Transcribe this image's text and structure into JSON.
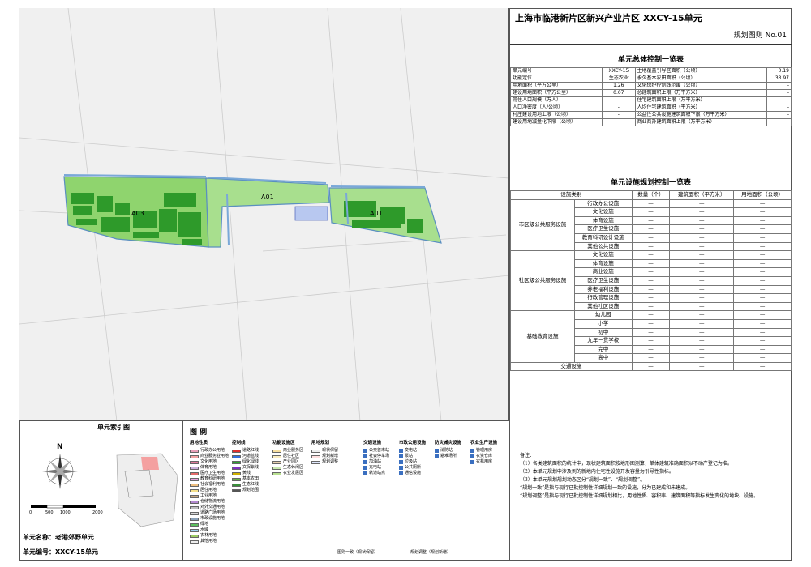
{
  "title": {
    "main": "上海市临港新片区新兴产业片区 XXCY-15单元",
    "sub": "规划图则 No.01"
  },
  "map": {
    "labels": [
      "A03",
      "A01",
      "A01"
    ]
  },
  "table1": {
    "title": "单元总体控制一览表",
    "rows": [
      [
        "单元编号",
        "XXCY-15",
        "主地覆盖引导区面积（公顷）",
        "0.19"
      ],
      [
        "功能定位",
        "生态农业",
        "永久基本农田面积（公顷）",
        "33.97"
      ],
      [
        "用地面积（平方公里）",
        "1.26",
        "文化保护控制线范围（公顷）",
        "-"
      ],
      [
        "建设用地面积（平方公里）",
        "0.07",
        "总建筑面积上限（万平方米）",
        "-"
      ],
      [
        "常住人口规模（万人）",
        "-",
        "住宅建筑面积上限（万平方米）",
        "-"
      ],
      [
        "人口净密度（人/公顷）",
        "-",
        "人均住宅建筑面积（平方米）",
        "-"
      ],
      [
        "村庄建设用地上限（公顷）",
        "-",
        "公益性公共设施建筑面积下限（万平方米）",
        "-"
      ],
      [
        "建设用地减量化下限（公顷）",
        "-",
        "商业商办建筑面积上限（万平方米）",
        "-"
      ]
    ]
  },
  "table2": {
    "title": "单元设施规划控制一览表",
    "headers": [
      "设施类别",
      "数量（个）",
      "建筑面积（平方米）",
      "用地面积（公顷）"
    ],
    "groups": [
      {
        "name": "市区级公共服务设施",
        "items": [
          "行政办公设施",
          "文化设施",
          "体育设施",
          "医疗卫生设施",
          "教育科研设计设施",
          "其他公共设施"
        ]
      },
      {
        "name": "社区级公共服务设施",
        "items": [
          "文化设施",
          "体育设施",
          "商业设施",
          "医疗卫生设施",
          "养老福利设施",
          "行政管理设施",
          "其他社区设施"
        ]
      },
      {
        "name": "基础教育设施",
        "items": [
          "幼儿园",
          "小学",
          "初中",
          "九年一贯学校",
          "完中",
          "高中"
        ]
      }
    ],
    "last_row": "交通设施",
    "dash": "—"
  },
  "notes": {
    "title": "备注：",
    "lines": [
      "（1）各类建筑面积的统计中，现状建筑面积按地形图测算，单体建筑准确面积以不动产登记为准。",
      "（2）本单元规划中涉及到的新地内住宅性设施开发容量为引导性指标。",
      "（3）本单元规划规划动态区分“规划一致”、“规划调整”。",
      "“规划一致”是指与现行已批控制性详细规划一致的设施，分为已建成和未建成。",
      "“规划调整”是指与现行已批控制性详细规划相比，用地性质、容积率、建筑面积等指标发生变化的地块、设施。"
    ]
  },
  "index_map": {
    "title": "单元索引图",
    "north": "N",
    "scale": [
      "0",
      "500",
      "1000",
      "2000"
    ]
  },
  "unit": {
    "name": "单元名称：老港郊野单元",
    "code": "单元编号：XXCY-15单元"
  },
  "legend": {
    "title": "图  例",
    "columns": [
      {
        "head": "用地性质",
        "items": [
          [
            "行政办公用地",
            "#e8a0b8"
          ],
          [
            "商业服务业用地",
            "#f2a3a3"
          ],
          [
            "文化用地",
            "#e07a9a"
          ],
          [
            "体育用地",
            "#c8b0d8"
          ],
          [
            "医疗卫生用地",
            "#e46a6a"
          ],
          [
            "教育科研用地",
            "#e9a2e0"
          ],
          [
            "社会福利用地",
            "#f0c080"
          ],
          [
            "居住用地",
            "#f5e08a"
          ],
          [
            "工业用地",
            "#c8a882"
          ],
          [
            "仓储物流用地",
            "#b48ad0"
          ],
          [
            "对外交通用地",
            "#c0c0c0"
          ],
          [
            "道路广场用地",
            "#d8d8d8"
          ],
          [
            "市政设施用地",
            "#8aa0b8"
          ],
          [
            "绿地",
            "#5cbf5c"
          ],
          [
            "水域",
            "#9ad0ee"
          ],
          [
            "农林用地",
            "#9ccc65"
          ],
          [
            "其他用地",
            "#eeeeee"
          ]
        ]
      },
      {
        "head": "控制线",
        "items": [
          [
            "道路红线",
            "#e03030"
          ],
          [
            "河道蓝线",
            "#3070e0"
          ],
          [
            "绿化绿线",
            "#30a030"
          ],
          [
            "文保紫线",
            "#8030c0"
          ],
          [
            "黄线",
            "#d0b000"
          ],
          [
            "基本农田",
            "#6ab04c"
          ],
          [
            "生态红线",
            "#3a8f3a"
          ],
          [
            "规划范围",
            "#555555"
          ]
        ]
      },
      {
        "head": "功能设施区",
        "items": [
          [
            "商业服务区",
            "#f8e0a0"
          ],
          [
            "居住社区",
            "#fbeec0"
          ],
          [
            "产业园区",
            "#e8d0b0"
          ],
          [
            "生态休闲区",
            "#c9e9b0"
          ],
          [
            "农业发展区",
            "#b8e090"
          ]
        ]
      },
      {
        "head": "用地规划",
        "items": [
          [
            "现状保留",
            "#eeeeee"
          ],
          [
            "规划新增",
            "#ffe0e0"
          ],
          [
            "规划调整",
            "#e0e8ff"
          ]
        ]
      }
    ],
    "icon_cols": [
      {
        "head": "交通设施",
        "items": [
          "公交首末站",
          "社会停车场",
          "加油站",
          "充电站",
          "轨道站点"
        ]
      },
      {
        "head": "市政公用设施",
        "items": [
          "变电站",
          "泵站",
          "垃圾站",
          "公共厕所",
          "通信设施"
        ]
      },
      {
        "head": "防灾减灾设施",
        "items": [
          "消防站",
          "避难场所"
        ]
      },
      {
        "head": "农业生产设施",
        "items": [
          "管理用房",
          "农资仓库",
          "农机用房"
        ]
      }
    ],
    "footer": [
      "图则一致（现状保留）",
      "规划调整（规划新增）"
    ]
  }
}
